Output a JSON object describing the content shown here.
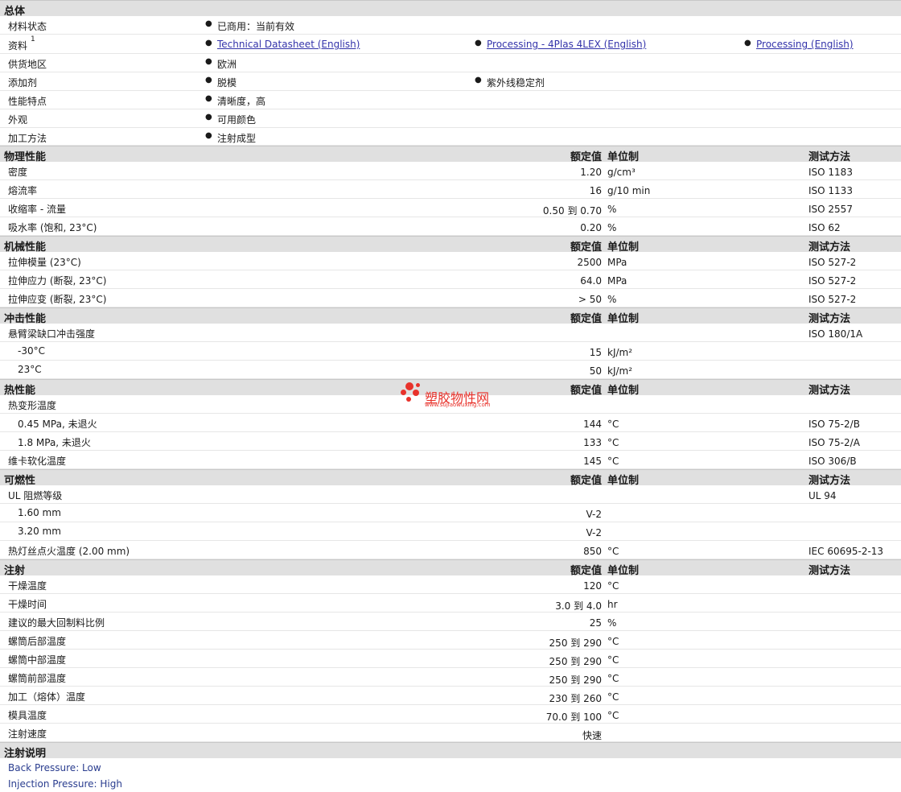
{
  "general": {
    "title": "总体",
    "rows": [
      {
        "label": "材料状态",
        "items": [
          "已商用：当前有效"
        ]
      },
      {
        "label": "资料",
        "sup": "1",
        "links": [
          "Technical Datasheet (English)",
          "Processing - 4Plas 4LEX (English)",
          "Processing (English)"
        ]
      },
      {
        "label": "供货地区",
        "items": [
          "欧洲"
        ]
      },
      {
        "label": "添加剂",
        "items": [
          "脱模",
          "紫外线稳定剂"
        ]
      },
      {
        "label": "性能特点",
        "items": [
          "清晰度，高"
        ]
      },
      {
        "label": "外观",
        "items": [
          "可用颜色"
        ]
      },
      {
        "label": "加工方法",
        "items": [
          "注射成型"
        ]
      }
    ]
  },
  "headers": {
    "nominal": "额定值",
    "unit": "单位制",
    "method": "测试方法"
  },
  "sections": {
    "physical": {
      "title": "物理性能",
      "rows": [
        {
          "label": "密度",
          "value": "1.20",
          "unit": "g/cm³",
          "method": "ISO 1183"
        },
        {
          "label": "熔流率",
          "value": "16",
          "unit": "g/10 min",
          "method": "ISO 1133"
        },
        {
          "label": "收缩率  - 流量",
          "value": "0.50 到  0.70",
          "unit": "%",
          "method": "ISO 2557"
        },
        {
          "label": "吸水率 (饱和, 23°C)",
          "value": "0.20",
          "unit": "%",
          "method": "ISO 62"
        }
      ]
    },
    "mechanical": {
      "title": "机械性能",
      "rows": [
        {
          "label": "拉伸模量 (23°C)",
          "value": "2500",
          "unit": "MPa",
          "method": "ISO 527-2"
        },
        {
          "label": "拉伸应力 (断裂, 23°C)",
          "value": "64.0",
          "unit": "MPa",
          "method": "ISO 527-2"
        },
        {
          "label": "拉伸应变 (断裂, 23°C)",
          "value": "> 50",
          "unit": "%",
          "method": "ISO 527-2"
        }
      ]
    },
    "impact": {
      "title": "冲击性能",
      "rows": [
        {
          "label": "悬臂梁缺口冲击强度",
          "value": "",
          "unit": "",
          "method": "ISO 180/1A"
        },
        {
          "label": "-30°C",
          "value": "15",
          "unit": "kJ/m²",
          "method": "",
          "sub": true
        },
        {
          "label": "23°C",
          "value": "50",
          "unit": "kJ/m²",
          "method": "",
          "sub": true
        }
      ]
    },
    "thermal": {
      "title": "热性能",
      "rows": [
        {
          "label": "热变形温度",
          "value": "",
          "unit": "",
          "method": ""
        },
        {
          "label": "0.45 MPa, 未退火",
          "value": "144",
          "unit": "°C",
          "method": "ISO 75-2/B",
          "sub": true
        },
        {
          "label": "1.8 MPa, 未退火",
          "value": "133",
          "unit": "°C",
          "method": "ISO 75-2/A",
          "sub": true
        },
        {
          "label": "维卡软化温度",
          "value": "145",
          "unit": "°C",
          "method": "ISO 306/B"
        }
      ]
    },
    "flammability": {
      "title": "可燃性",
      "rows": [
        {
          "label": "UL 阻燃等级",
          "value": "",
          "unit": "",
          "method": "UL 94"
        },
        {
          "label": "1.60 mm",
          "value": "V-2",
          "unit": "",
          "method": "",
          "sub": true
        },
        {
          "label": "3.20 mm",
          "value": "V-2",
          "unit": "",
          "method": "",
          "sub": true
        },
        {
          "label": "热灯丝点火温度 (2.00 mm)",
          "value": "850",
          "unit": "°C",
          "method": "IEC 60695-2-13"
        }
      ]
    },
    "injection": {
      "title": "注射",
      "rows": [
        {
          "label": "干燥温度",
          "value": "120",
          "unit": "°C",
          "method": ""
        },
        {
          "label": "干燥时间",
          "value": "3.0 到  4.0",
          "unit": "hr",
          "method": ""
        },
        {
          "label": "建议的最大回制料比例",
          "value": "25",
          "unit": "%",
          "method": ""
        },
        {
          "label": "螺筒后部温度",
          "value": "250 到  290",
          "unit": "°C",
          "method": ""
        },
        {
          "label": "螺筒中部温度",
          "value": "250 到  290",
          "unit": "°C",
          "method": ""
        },
        {
          "label": "螺筒前部温度",
          "value": "250 到  290",
          "unit": "°C",
          "method": ""
        },
        {
          "label": "加工（熔体）温度",
          "value": "230 到  260",
          "unit": "°C",
          "method": ""
        },
        {
          "label": "模具温度",
          "value": "70.0 到  100",
          "unit": "°C",
          "method": ""
        },
        {
          "label": "注射速度",
          "value": "快速",
          "unit": "",
          "method": ""
        }
      ]
    }
  },
  "notes": {
    "title": "注射说明",
    "lines": [
      "Back Pressure: Low",
      "Injection Pressure: High"
    ]
  },
  "watermark": {
    "name": "塑胶物性网",
    "url": "www.sujiaowuxing.com"
  }
}
